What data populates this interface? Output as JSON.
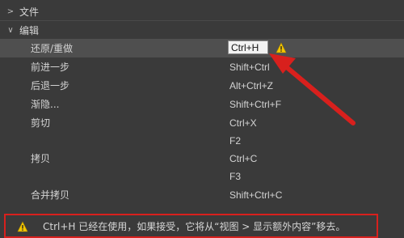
{
  "sections": {
    "file": {
      "chevron": ">",
      "title": "文件"
    },
    "edit": {
      "chevron": "∨",
      "title": "编辑"
    }
  },
  "shortcuts": [
    {
      "command": "还原/重做",
      "key": "Ctrl+H",
      "selected": true
    },
    {
      "command": "前进一步",
      "key": "Shift+Ctrl"
    },
    {
      "command": "后退一步",
      "key": "Alt+Ctrl+Z"
    },
    {
      "command": "渐隐...",
      "key": "Shift+Ctrl+F"
    },
    {
      "command": "剪切",
      "key": "Ctrl+X"
    },
    {
      "command": "",
      "key": "F2"
    },
    {
      "command": "拷贝",
      "key": "Ctrl+C"
    },
    {
      "command": "",
      "key": "F3"
    },
    {
      "command": "合并拷贝",
      "key": "Shift+Ctrl+C"
    }
  ],
  "warning": {
    "message": "Ctrl+H 已经在使用，如果接受，它将从“视图 > 显示额外内容”移去。"
  },
  "colors": {
    "background": "#3a3a3a",
    "selected_row": "#4f4f4f",
    "annotation_red": "#d8201d",
    "warning_yellow": "#f2c500"
  },
  "icons": {
    "warning": "warning-triangle-icon",
    "annotation": "red-arrow-annotation"
  }
}
